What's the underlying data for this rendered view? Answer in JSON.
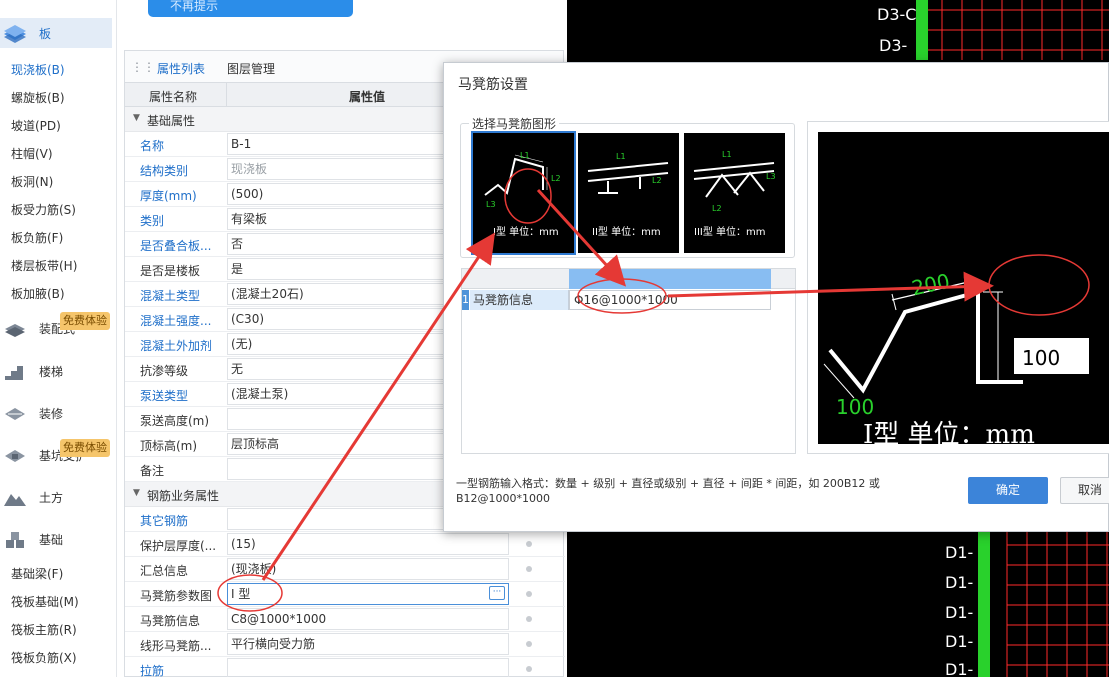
{
  "sidebar": {
    "top_category": {
      "label": "板",
      "icon": "slab-icon"
    },
    "slab_items": [
      "现浇板(B)",
      "螺旋板(B)",
      "坡道(PD)",
      "柱帽(V)",
      "板洞(N)",
      "板受力筋(S)",
      "板负筋(F)",
      "楼层板带(H)",
      "板加腋(B)"
    ],
    "categories": [
      {
        "label": "装配式",
        "icon": "prefab-icon",
        "badge": "免费体验"
      },
      {
        "label": "楼梯",
        "icon": "stairs-icon"
      },
      {
        "label": "装修",
        "icon": "decoration-icon"
      },
      {
        "label": "基坑支护",
        "icon": "pit-support-icon",
        "badge": "免费体验"
      },
      {
        "label": "土方",
        "icon": "earthwork-icon"
      },
      {
        "label": "基础",
        "icon": "foundation-icon"
      }
    ],
    "foundation_items": [
      "基础梁(F)",
      "筏板基础(M)",
      "筏板主筋(R)",
      "筏板负筋(X)"
    ]
  },
  "top_tip": "不再提示",
  "panel": {
    "tabs": [
      "属性列表",
      "图层管理"
    ],
    "headers": {
      "name": "属性名称",
      "value": "属性值"
    },
    "section_basic": "基础属性",
    "rows_basic": [
      {
        "name": "名称",
        "value": "B-1",
        "link": true
      },
      {
        "name": "结构类别",
        "value": "现浇板",
        "link": true,
        "gray": true
      },
      {
        "name": "厚度(mm)",
        "value": "(500)",
        "link": true
      },
      {
        "name": "类别",
        "value": "有梁板",
        "link": true
      },
      {
        "name": "是否叠合板...",
        "value": "否",
        "link": true
      },
      {
        "name": "是否是楼板",
        "value": "是",
        "link": false
      },
      {
        "name": "混凝土类型",
        "value": "(混凝土20石)",
        "link": true
      },
      {
        "name": "混凝土强度...",
        "value": "(C30)",
        "link": true
      },
      {
        "name": "混凝土外加剂",
        "value": "(无)",
        "link": true
      },
      {
        "name": "抗渗等级",
        "value": "无",
        "link": false
      },
      {
        "name": "泵送类型",
        "value": "(混凝土泵)",
        "link": true
      },
      {
        "name": "泵送高度(m)",
        "value": "",
        "link": false
      },
      {
        "name": "顶标高(m)",
        "value": "层顶标高",
        "link": false
      },
      {
        "name": "备注",
        "value": "",
        "link": false
      }
    ],
    "section_rebar": "钢筋业务属性",
    "rows_rebar": [
      {
        "name": "其它钢筋",
        "value": "",
        "link": true
      },
      {
        "name": "保护层厚度(...",
        "value": "(15)",
        "link": false
      },
      {
        "name": "汇总信息",
        "value": "(现浇板)",
        "link": false
      },
      {
        "name": "马凳筋参数图",
        "value": "I 型",
        "link": false,
        "editing": true
      },
      {
        "name": "马凳筋信息",
        "value": "C8@1000*1000",
        "link": false
      },
      {
        "name": "线形马凳筋...",
        "value": "平行横向受力筋",
        "link": false
      },
      {
        "name": "拉筋",
        "value": "",
        "link": true
      }
    ]
  },
  "cad_labels_top": [
    "D3-C",
    "D3-"
  ],
  "cad_labels_bottom": [
    "D1-",
    "D1-",
    "D1-",
    "D1-",
    "D1-"
  ],
  "dialog": {
    "title": "马凳筋设置",
    "shape_group_label": "选择马凳筋图形",
    "shapes": [
      {
        "caption": "I型 单位：mm",
        "selected": true
      },
      {
        "caption": "II型 单位：mm",
        "selected": false
      },
      {
        "caption": "III型 单位：mm",
        "selected": false
      }
    ],
    "thumb_dims": [
      "L1",
      "L2",
      "L3"
    ],
    "grid_row": {
      "num": "1",
      "name": "马凳筋信息",
      "value": "16@1000*1000",
      "grade_symbol": "Φ"
    },
    "preview": {
      "dim_top": "200",
      "dim_side": "100",
      "dim_bottom": "100",
      "caption": "I型 单位：mm"
    },
    "help_text": "一型钢筋输入格式：数量 + 级别 + 直径或级别 + 直径 + 间距 * 间距，如 200B12 或 B12@1000*1000",
    "ok": "确定",
    "cancel": "取消"
  },
  "colors": {
    "accent": "#1f6fc9",
    "annotation": "#e53935",
    "dim_green": "#29d12c",
    "grid_red": "#ff2a2a"
  }
}
